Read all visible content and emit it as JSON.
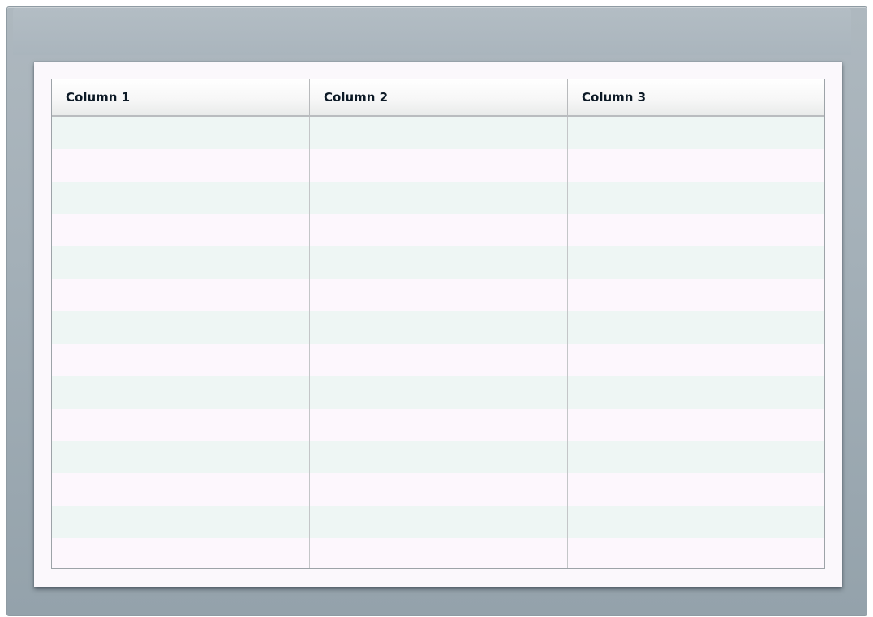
{
  "grid": {
    "columns": [
      {
        "label": "Column 1"
      },
      {
        "label": "Column 2"
      },
      {
        "label": "Column 3"
      }
    ],
    "row_count": 14
  },
  "colors": {
    "window_frame": "#a4b0b8",
    "panel_background": "#fbf8fc",
    "row_alt": "#eef6f4",
    "row_base": "#fdf7fd",
    "header_text": "#0d1a26"
  }
}
